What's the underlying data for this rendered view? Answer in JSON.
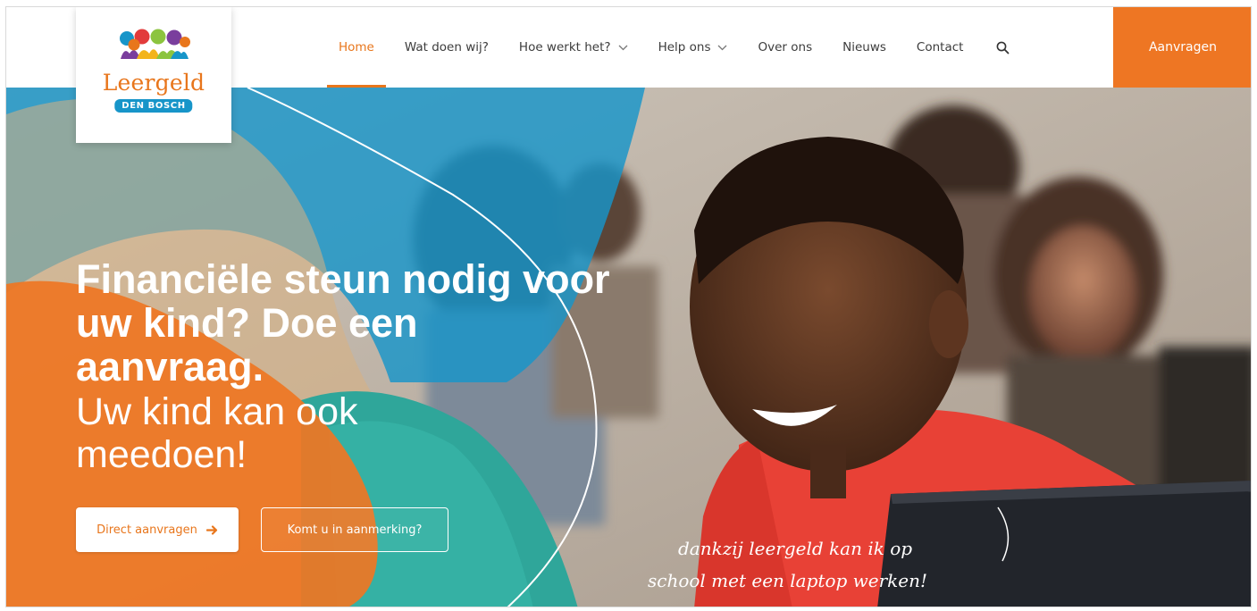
{
  "brand": {
    "name": "Leergeld",
    "sub": "DEN BOSCH",
    "logo_icon": "people-group-logo-icon",
    "colors": {
      "orange": "#ee7623",
      "blue": "#1795c9"
    }
  },
  "nav": {
    "items": [
      {
        "label": "Home",
        "active": true,
        "dropdown": false
      },
      {
        "label": "Wat doen wij?",
        "active": false,
        "dropdown": false
      },
      {
        "label": "Hoe werkt het?",
        "active": false,
        "dropdown": true
      },
      {
        "label": "Help ons",
        "active": false,
        "dropdown": true
      },
      {
        "label": "Over ons",
        "active": false,
        "dropdown": false
      },
      {
        "label": "Nieuws",
        "active": false,
        "dropdown": false
      },
      {
        "label": "Contact",
        "active": false,
        "dropdown": false
      }
    ],
    "search_icon": "search-icon",
    "cta_label": "Aanvragen"
  },
  "hero": {
    "title": "Financiële steun nodig voor uw kind? Doe een aanvraag.",
    "subtitle": "Uw kind kan ook meedoen!",
    "primary_button": "Direct aanvragen",
    "primary_button_icon": "arrow-right-icon",
    "secondary_button": "Komt u in aanmerking?",
    "handwritten_line1": "dankzij leergeld kan ik op",
    "handwritten_line2": "school met een laptop werken!"
  }
}
